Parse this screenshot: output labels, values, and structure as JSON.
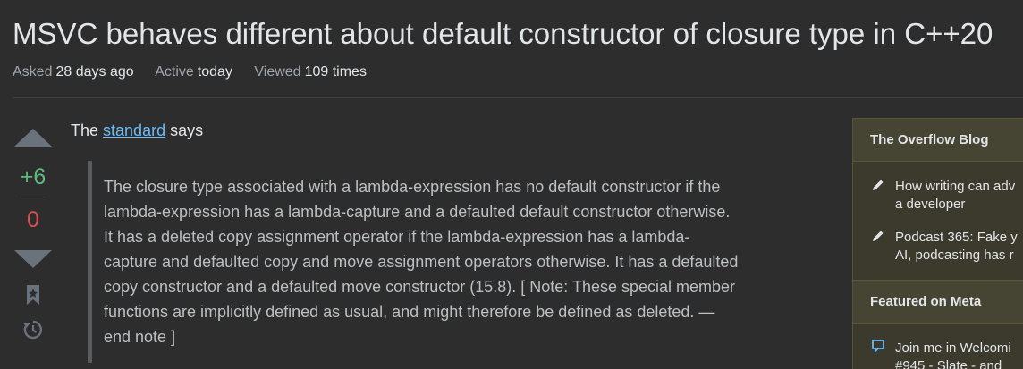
{
  "question": {
    "title": "MSVC behaves different about default constructor of closure type in C++20",
    "meta": {
      "asked_label": "Asked",
      "asked_value": "28 days ago",
      "active_label": "Active",
      "active_value": "today",
      "viewed_label": "Viewed",
      "viewed_value": "109 times"
    }
  },
  "votes": {
    "score": "+6",
    "downvotes": "0"
  },
  "post": {
    "intro_before": "The ",
    "intro_link": "standard",
    "intro_after": " says",
    "quote_lines": [
      "The closure type associated with a lambda-expression has no default constructor if the",
      "lambda-expression has a lambda-capture and a defaulted default constructor otherwise.",
      "It has a deleted copy assignment operator if the lambda-expression has a lambda-",
      "capture and defaulted copy and move assignment operators otherwise. It has a defaulted",
      "copy constructor and a defaulted move constructor (15.8). [ Note: These special member",
      "functions are implicitly defined as usual, and might therefore be defined as deleted. —",
      "end note ]"
    ]
  },
  "sidebar": {
    "blog_heading": "The Overflow Blog",
    "blog_items": [
      {
        "line1": "How writing can adv",
        "line2": "a developer",
        "icon": "pencil-icon"
      },
      {
        "line1": "Podcast 365: Fake y",
        "line2": "AI, podcasting has r",
        "icon": "pencil-icon"
      }
    ],
    "meta_heading": "Featured on Meta",
    "meta_items": [
      {
        "line1": "Join me in Welcomi",
        "line2": "#945 - Slate - and",
        "icon": "chat-icon"
      }
    ]
  },
  "colors": {
    "background": "#2d2d2d",
    "score_positive": "#5fba7d",
    "score_negative": "#de4f54",
    "link": "#6cbbf7",
    "sidebar_bg": "#3b3a2c"
  }
}
